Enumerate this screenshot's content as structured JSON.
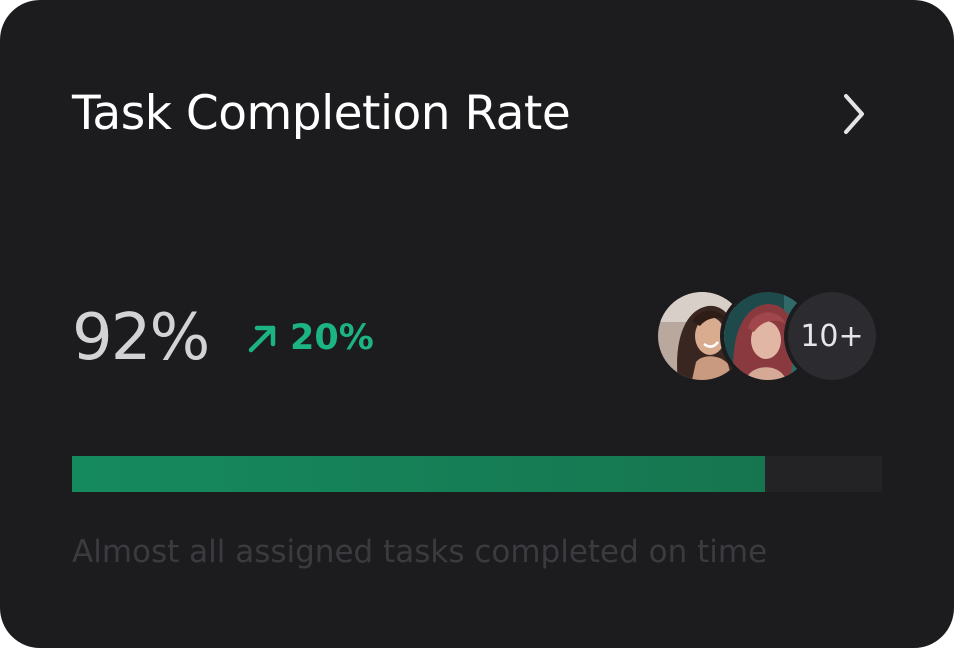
{
  "card": {
    "title": "Task Completion Rate",
    "value": "92%",
    "trend": {
      "direction": "up",
      "icon": "arrow-up-right-icon",
      "text": "20%",
      "color": "#1db483"
    },
    "avatars": {
      "more_label": "10+",
      "count_shown": 2
    },
    "progress": {
      "value": 0.855,
      "fill_color": "#168a5f"
    },
    "caption": "Almost all assigned tasks completed on time",
    "open_icon": "chevron-right-icon"
  }
}
